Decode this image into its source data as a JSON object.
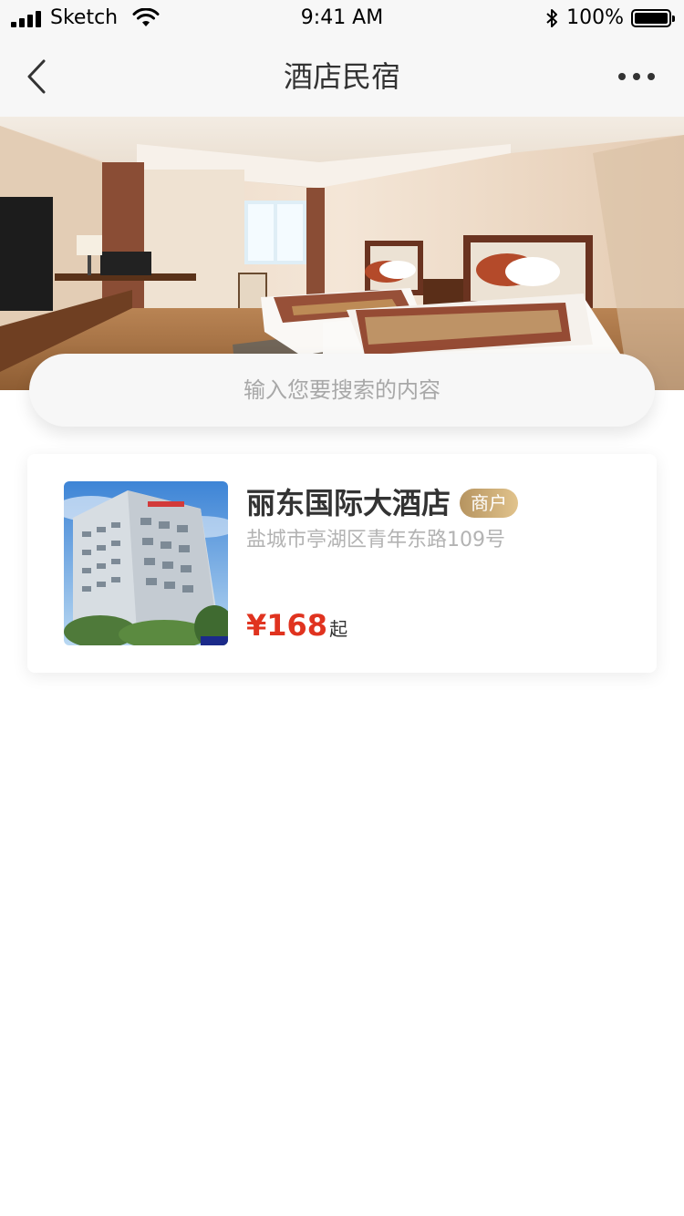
{
  "status_bar": {
    "carrier": "Sketch",
    "time": "9:41 AM",
    "battery": "100%",
    "icons": [
      "signal-icon",
      "wifi-icon",
      "bluetooth-icon",
      "battery-icon"
    ]
  },
  "nav": {
    "title": "酒店民宿",
    "back_icon": "chevron-left-icon",
    "more_icon": "more-dots-icon"
  },
  "banner": {
    "image": "hotel-room-photo"
  },
  "search": {
    "placeholder": "输入您要搜索的内容",
    "value": ""
  },
  "hotels": [
    {
      "name": "丽东国际大酒店",
      "badge": "商户",
      "address": "盐城市亭湖区青年东路109号",
      "price": "¥168",
      "price_suffix": "起",
      "image": "hotel-building-photo"
    }
  ],
  "colors": {
    "price": "#e0331f",
    "badge_start": "#b69460",
    "badge_end": "#e1c38c",
    "nav_bg": "#f7f7f7"
  }
}
